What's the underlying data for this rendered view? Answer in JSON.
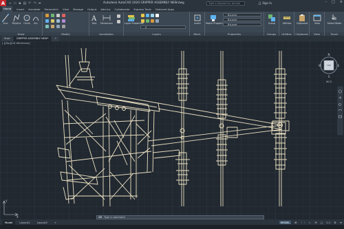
{
  "titlebar": {
    "logo": "A",
    "title": "Autodesk AutoCAD 2020   GRIPPER ASSEMBLY NEW.dwg",
    "search_placeholder": "Type a keyword or phrase",
    "user": "Sign In",
    "window_controls": [
      "–",
      "□",
      "×"
    ]
  },
  "ribbon_tabs": [
    "Home",
    "Insert",
    "Annotate",
    "Parametric",
    "View",
    "Manage",
    "Output",
    "Add-ins",
    "Collaborate",
    "Express Tools",
    "Featured Apps"
  ],
  "ribbon": {
    "panels": {
      "draw": "Draw",
      "modify": "Modify",
      "annotation": "Annotation",
      "layers": "Layers",
      "block": "Block",
      "properties": "Properties",
      "groups": "Groups",
      "utilities": "Utilities",
      "clipboard": "Clipboard",
      "view": "View",
      "touch": "Touch"
    },
    "tools": {
      "line": "Line",
      "polyline": "Polyline",
      "circle": "Circle",
      "arc": "Arc",
      "text": "Text",
      "dimension": "Dimension",
      "layer_properties": "Layer Properties",
      "insert": "Insert",
      "match_properties": "Match Properties",
      "group": "Group",
      "utilities": "Utilities",
      "clipboard": "Clipboard",
      "view": "View",
      "select_mode": "Select Mode",
      "touch": "Touch"
    },
    "property_values": [
      "ByLayer",
      "ByLayer",
      "ByLayer"
    ]
  },
  "file_tabs": [
    "Start",
    "GRIPPER ASSEMBLY NEW*"
  ],
  "view_label": "[-][Top][2D Wireframe]",
  "viewcube": {
    "n": "N",
    "s": "S",
    "e": "E",
    "w": "W",
    "face": "TOP",
    "wcs": "WCS"
  },
  "ucs": {
    "x": "X",
    "y": "Y"
  },
  "command_line": {
    "placeholder": "Type a command"
  },
  "layout_tabs": [
    "Model",
    "Layout1",
    "Layout2"
  ],
  "status": {
    "model": "MODEL",
    "scale": "1:1"
  }
}
